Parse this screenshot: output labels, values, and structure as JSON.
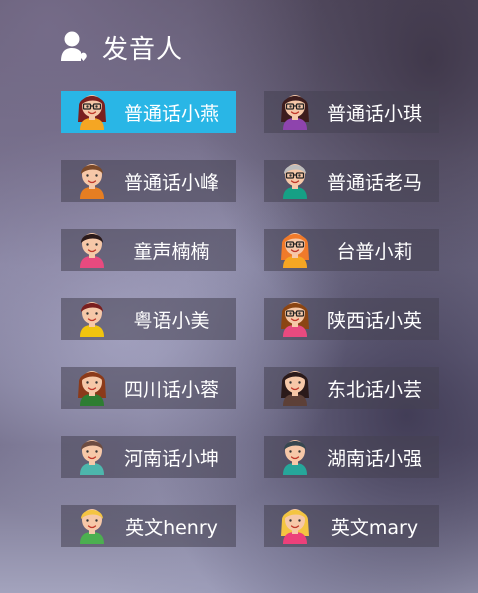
{
  "header": {
    "title": "发音人",
    "icon": "user-voice-icon"
  },
  "voices": [
    {
      "label": "普通话小燕",
      "active": true,
      "hair": "#7a1f1f",
      "skin": "#f6c8a8",
      "shirt": "#f5a623",
      "glasses": true,
      "long": true
    },
    {
      "label": "普通话小琪",
      "active": false,
      "hair": "#3d1d1d",
      "skin": "#f6c8a8",
      "shirt": "#8e44ad",
      "glasses": true,
      "long": true
    },
    {
      "label": "普通话小峰",
      "active": false,
      "hair": "#7b4a2a",
      "skin": "#f6c8a8",
      "shirt": "#e67e22",
      "glasses": false,
      "long": false
    },
    {
      "label": "普通话老马",
      "active": false,
      "hair": "#bdbdbd",
      "skin": "#f6c8a8",
      "shirt": "#16a085",
      "glasses": true,
      "long": false
    },
    {
      "label": "童声楠楠",
      "active": false,
      "hair": "#2b1a1a",
      "skin": "#f6c8a8",
      "shirt": "#e84a7f",
      "glasses": false,
      "long": false
    },
    {
      "label": "台普小莉",
      "active": false,
      "hair": "#f07a2a",
      "skin": "#f6c8a8",
      "shirt": "#f5a623",
      "glasses": true,
      "long": true
    },
    {
      "label": "粤语小美",
      "active": false,
      "hair": "#7a1f1f",
      "skin": "#f6c8a8",
      "shirt": "#f1c40f",
      "glasses": false,
      "long": false
    },
    {
      "label": "陕西话小英",
      "active": false,
      "hair": "#8b4513",
      "skin": "#f6c8a8",
      "shirt": "#e84a7f",
      "glasses": true,
      "long": true
    },
    {
      "label": "四川话小蓉",
      "active": false,
      "hair": "#8b3a1a",
      "skin": "#f6c8a8",
      "shirt": "#2e7d32",
      "glasses": false,
      "long": true
    },
    {
      "label": "东北话小芸",
      "active": false,
      "hair": "#2b1a1a",
      "skin": "#f6c8a8",
      "shirt": "#5d4037",
      "glasses": false,
      "long": true
    },
    {
      "label": "河南话小坤",
      "active": false,
      "hair": "#6d4c41",
      "skin": "#f6c8a8",
      "shirt": "#4db6ac",
      "glasses": false,
      "long": false
    },
    {
      "label": "湖南话小强",
      "active": false,
      "hair": "#37474f",
      "skin": "#f6c8a8",
      "shirt": "#26a69a",
      "glasses": false,
      "long": false
    },
    {
      "label": "英文henry",
      "active": false,
      "hair": "#f4c542",
      "skin": "#f6c8a8",
      "shirt": "#4caf50",
      "glasses": false,
      "long": false
    },
    {
      "label": "英文mary",
      "active": false,
      "hair": "#f4c542",
      "skin": "#f6c8a8",
      "shirt": "#ec407a",
      "glasses": false,
      "long": true
    }
  ]
}
